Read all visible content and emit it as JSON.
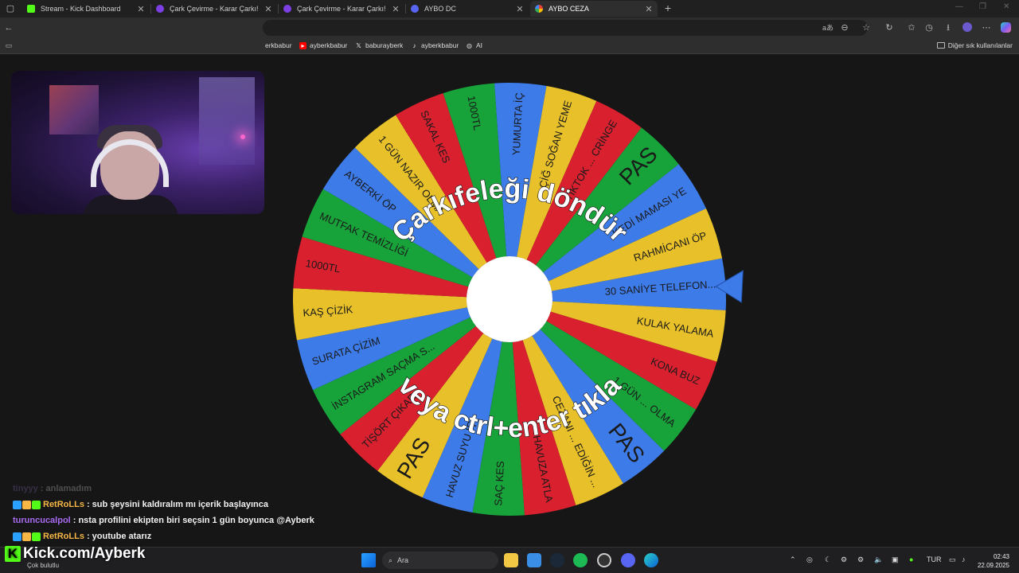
{
  "browser": {
    "tabs": [
      {
        "title": "Stream - Kick Dashboard",
        "color": "#53fc18"
      },
      {
        "title": "Çark Çevirme - Karar Çarkı!",
        "color": "#7b3fe4"
      },
      {
        "title": "Çark Çevirme - Karar Çarkı!",
        "color": "#7b3fe4"
      },
      {
        "title": "AYBO DC",
        "color": "#5865f2"
      },
      {
        "title": "AYBO CEZA",
        "color": "#4285f4"
      }
    ],
    "new_tab": "+",
    "bookmarks": [
      {
        "label": "erkbabur",
        "icon": ""
      },
      {
        "label": "ayberkbabur",
        "icon": "youtube-icon"
      },
      {
        "label": "baburayberk",
        "icon": "x-icon"
      },
      {
        "label": "ayberkbabur",
        "icon": "tiktok-icon"
      },
      {
        "label": "AI",
        "icon": "globe-icon"
      }
    ],
    "other_bookmarks": "Diğer sık kullanılanlar"
  },
  "wheel": {
    "center_color": "#ffffff",
    "pointer_color": "#3d7be8",
    "prompt_top": "Çarkıfeleği döndür",
    "prompt_bottom": "veya ctrl+enter tıkla",
    "colors": [
      "#3d7be8",
      "#e8c12a",
      "#d8202f",
      "#17a33a"
    ],
    "segments": [
      "30 SANİYE TELEFON...",
      "KULAK YALAMA",
      "KONA BUZ",
      "1 GÜN ... OLMA",
      "PAS",
      "CEZANI ... EDİĞİN ...",
      "HAVUZA ATLA",
      "SAÇ KES",
      "HAVUZ SUYU İÇ",
      "PAS",
      "TİŞÖRT ÇIKAR",
      "İNSTAGRAM SAÇMA S...",
      "SURATA ÇİZİM",
      "KAŞ ÇİZİK",
      "1000TL",
      "MUTFAK TEMİZLİĞİ",
      "AYBERKİ ÖP",
      "1 GÜN NAZIR OLMA",
      "SAKAL KES",
      "1000TL",
      "YUMURTA İÇ",
      "ÇİĞ SOĞAN YEME",
      "TİKTOK ... CRİNGE",
      "PAS",
      "KEDİ MAMASI YE",
      "RAHMİCANI ÖP"
    ]
  },
  "chat": [
    {
      "user": "tinyyy",
      "message": ": anlamadım",
      "color": "#9a7bd0",
      "badges": false,
      "faded": true
    },
    {
      "user": "RetRoLLs",
      "message": ": sub şeysini kaldıralım mı içerik başlayınca",
      "color": "#f5b646",
      "badges": true,
      "faded": false
    },
    {
      "user": "turuncucalpol",
      "message": ": nsta profilini ekipten biri seçsin 1 gün boyunca @Ayberk",
      "color": "#a76bf0",
      "badges": false,
      "faded": false
    },
    {
      "user": "RetRoLLs",
      "message": ": youtube atarız",
      "color": "#f5b646",
      "badges": true,
      "faded": false
    }
  ],
  "kick_overlay": "Kick.com/Ayberk",
  "taskbar": {
    "weather": "Çok bulutlu",
    "search_placeholder": "Ara",
    "language": "TUR",
    "time": "02:43",
    "date": "22.09.2025"
  }
}
